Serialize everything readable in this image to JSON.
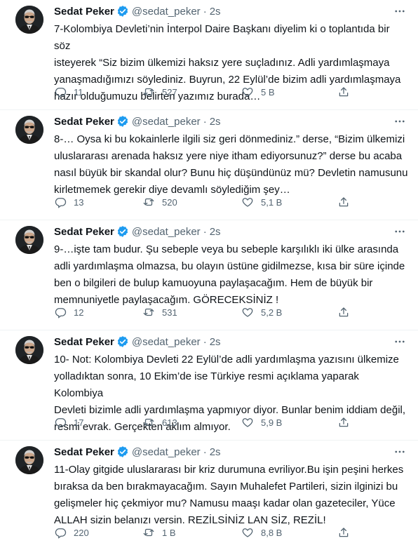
{
  "author": {
    "name": "Sedat Peker",
    "handle": "@sedat_peker",
    "time": "2s",
    "sep": "·"
  },
  "colors": {
    "text": "#0f1419",
    "secondary": "#536471",
    "verified": "#1d9bf0",
    "divider": "#eff3f4"
  },
  "icons": {
    "reply": "reply-icon",
    "retweet": "retweet-icon",
    "like": "heart-icon",
    "share": "share-icon",
    "verified": "verified-badge-icon",
    "more": "more-icon"
  },
  "tweets": [
    {
      "text": "7-Kolombiya Devleti’nin İnterpol Daire Başkanı diyelim ki o toplantıda bir söz\nisteyerek “Siz bizim ülkemizi haksız yere suçladınız. Adli yardımlaşmaya\nyanaşmadığımızı söylediniz. Buyrun, 22 Eylül’de bizim adli yardımlaşmaya\nhazır olduğumuzu belirten yazımız burada…",
      "replies": "11",
      "retweets": "527",
      "likes": "5 B"
    },
    {
      "text": "8-… Oysa ki bu kokainlerle ilgili siz geri dönmediniz.” derse, “Bizim ülkemizi\nuluslararası arenada haksız yere niye itham ediyorsunuz?” derse bu acaba\nnasıl büyük bir skandal olur? Bunu hiç düşündünüz mü? Devletin namusunu\nkirletmemek gerekir diye devamlı söylediğim şey…",
      "replies": "13",
      "retweets": "520",
      "likes": "5,1 B"
    },
    {
      "text": "9-…işte tam budur. Şu sebeple veya bu sebeple karşılıklı iki ülke arasında\nadli yardımlaşma olmazsa, bu olayın üstüne gidilmezse, kısa bir süre içinde\nben o bilgileri de bulup kamuoyuna paylaşacağım. Hem de büyük bir\nmemnuniyetle paylaşacağım. GÖRECEKSİNİZ !",
      "replies": "12",
      "retweets": "531",
      "likes": "5,2 B"
    },
    {
      "text": "10- Not: Kolombiya Devleti 22 Eylül’de adli yardımlaşma yazısını ülkemize\nyolladıktan sonra, 10 Ekim’de ise Türkiye resmi açıklama yaparak Kolombiya\nDevleti bizimle adli yardımlaşma yapmıyor diyor. Bunlar benim iddiam değil,\nresmi evrak. Gerçekten aklım almıyor.",
      "replies": "17",
      "retweets": "613",
      "likes": "5,9 B"
    },
    {
      "text": "11-Olay gitgide uluslararası bir kriz durumuna evriliyor.Bu işin peşini herkes\nbıraksa da ben bırakmayacağım. Sayın Muhalefet Partileri, sizin ilginizi bu\ngelişmeler hiç çekmiyor mu? Namusu maaşı kadar olan gazeteciler, Yüce\nALLAH sizin belanızı versin. REZİLSİNİZ LAN SİZ, REZİL!",
      "replies": "220",
      "retweets": "1 B",
      "likes": "8,8 B"
    }
  ]
}
